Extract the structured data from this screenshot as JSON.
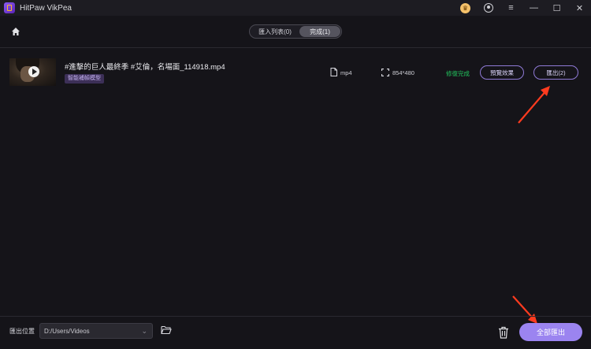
{
  "app": {
    "title": "HitPaw VikPea"
  },
  "window_controls": {
    "crown_icon": "crown-icon",
    "user_icon": "user-icon",
    "menu": "≡",
    "minimize": "—",
    "maximize": "☐",
    "close": "✕"
  },
  "header": {
    "tabs": [
      {
        "label": "匯入列表(0)",
        "active": false
      },
      {
        "label": "完成(1)",
        "active": true
      }
    ]
  },
  "file": {
    "name": "#進擊的巨人最終季  #艾倫，名場面_114918.mp4",
    "model_tag": "智能補幀模型",
    "format": "mp4",
    "resolution": "854*480",
    "status": "修復完成",
    "preview_label": "預覽效果",
    "export_label": "匯出(2)"
  },
  "footer": {
    "location_label": "匯出位置",
    "path": "D:/Users/Videos",
    "export_all_label": "全部匯出"
  },
  "colors": {
    "accent": "#9b84f0",
    "success": "#22c55e",
    "arrow": "#ff3b1f"
  }
}
